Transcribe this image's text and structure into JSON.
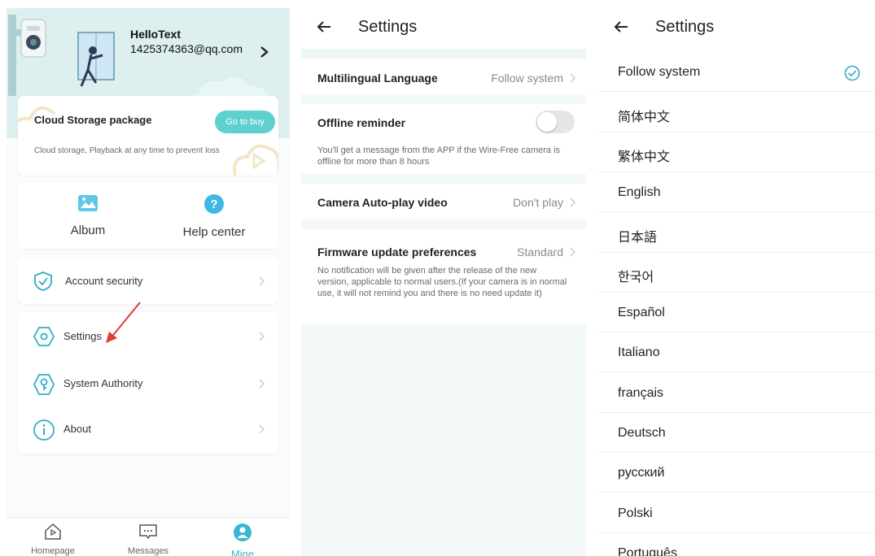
{
  "mine": {
    "user": {
      "name": "HelloText",
      "email": "1425374363@qq.com"
    },
    "cloud": {
      "title": "Cloud Storage package",
      "desc": "Cloud storage, Playback at any time to prevent loss",
      "buy": "Go to buy"
    },
    "quick": [
      {
        "label": "Album",
        "icon": "album-icon"
      },
      {
        "label": "Help center",
        "icon": "help-icon"
      }
    ],
    "account": {
      "label": "Account security",
      "icon": "shield-check-icon"
    },
    "menu": [
      {
        "label": "Settings",
        "icon": "settings-icon"
      },
      {
        "label": "System Authority",
        "icon": "key-shield-icon"
      },
      {
        "label": "About",
        "icon": "info-icon"
      }
    ],
    "tabs": [
      {
        "label": "Homepage",
        "icon": "home-icon"
      },
      {
        "label": "Messages",
        "icon": "messages-icon"
      },
      {
        "label": "Mine",
        "icon": "user-icon"
      }
    ],
    "accent": "#38b8c8"
  },
  "settings": {
    "title": "Settings",
    "rows": [
      {
        "key": "Multilingual Language",
        "value": "Follow system"
      },
      {
        "key": "Offline reminder",
        "toggle": false,
        "note": "You'll get a message from the APP if the Wire-Free camera is offline for more than 8 hours"
      },
      {
        "key": "Camera Auto-play video",
        "value": "Don't play"
      },
      {
        "key": "Firmware update preferences",
        "value": "Standard",
        "note": "No notification will be given after the release of the new version, applicable to normal users.(If your camera is in normal use, it will not remind you and there is no need update it)"
      }
    ]
  },
  "language": {
    "title": "Settings",
    "selected": "Follow system",
    "options": [
      "Follow system",
      "简体中文",
      "繁体中文",
      "English",
      "日本語",
      "한국어",
      "Español",
      "Italiano",
      "français",
      "Deutsch",
      "русский",
      "Polski",
      "Português"
    ]
  }
}
